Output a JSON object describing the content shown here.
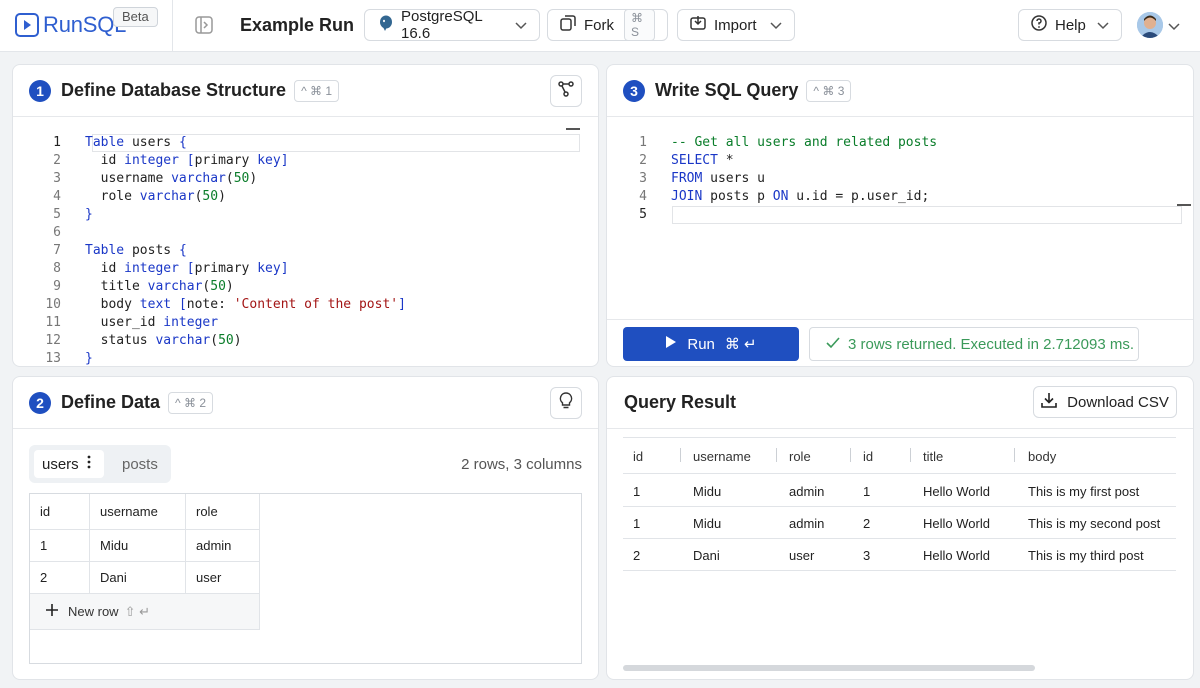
{
  "app": {
    "name": "RunSQL",
    "badge": "Beta"
  },
  "header": {
    "run_title": "Example Run",
    "db_select": "PostgreSQL 16.6",
    "fork_label": "Fork",
    "fork_shortcut": "⌘ S",
    "import_label": "Import",
    "help_label": "Help"
  },
  "structure_panel": {
    "step": "1",
    "title": "Define Database Structure",
    "shortcut": "^ ⌘ 1",
    "line_numbers": [
      "1",
      "2",
      "3",
      "4",
      "5",
      "6",
      "7",
      "8",
      "9",
      "10",
      "11",
      "12",
      "13"
    ]
  },
  "query_panel": {
    "step": "3",
    "title": "Write SQL Query",
    "shortcut": "^ ⌘ 3",
    "line_numbers": [
      "1",
      "2",
      "3",
      "4",
      "5"
    ],
    "run_label": "Run",
    "run_shortcut": "⌘ ↵",
    "status": "3 rows returned. Executed in 2.712093 ms."
  },
  "data_panel": {
    "step": "2",
    "title": "Define Data",
    "shortcut": "^ ⌘ 2",
    "tabs": [
      "users",
      "posts"
    ],
    "row_info": "2 rows, 3 columns",
    "columns": [
      "id",
      "username",
      "role"
    ],
    "rows": [
      [
        "1",
        "Midu",
        "admin"
      ],
      [
        "2",
        "Dani",
        "user"
      ]
    ],
    "new_row_label": "New row",
    "new_row_shortcut": "⇧ ↵"
  },
  "results_panel": {
    "title": "Query Result",
    "download_label": "Download CSV",
    "columns": [
      "id",
      "username",
      "role",
      "id",
      "title",
      "body"
    ],
    "rows": [
      [
        "1",
        "Midu",
        "admin",
        "1",
        "Hello World",
        "This is my first post"
      ],
      [
        "1",
        "Midu",
        "admin",
        "2",
        "Hello World",
        "This is my second post"
      ],
      [
        "2",
        "Dani",
        "user",
        "3",
        "Hello World",
        "This is my third post"
      ]
    ]
  },
  "colors": {
    "accent": "#1f4fc0",
    "success": "#3b9a5a",
    "keyword": "#1a37c7",
    "number": "#0a7d2a",
    "string": "#a31515"
  }
}
